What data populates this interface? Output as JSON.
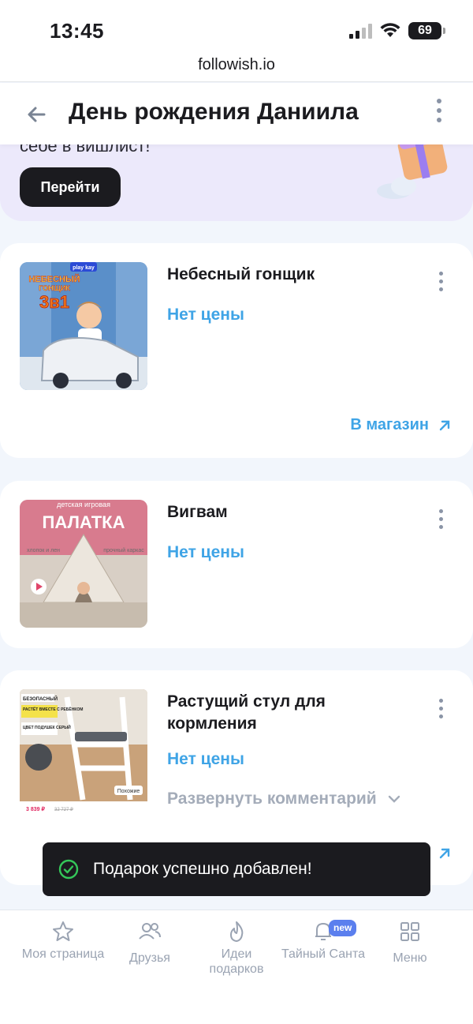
{
  "status_bar": {
    "time": "13:45",
    "battery": "69"
  },
  "browser": {
    "url": "followish.io"
  },
  "header": {
    "title": "День рождения Даниила"
  },
  "promo": {
    "text": "себе в вишлист!",
    "button_label": "Перейти"
  },
  "items": [
    {
      "title": "Небесный гонщик",
      "price": "Нет цены",
      "shop_label": "В магазин",
      "image_text": {
        "brand": "play kay",
        "line1": "НЕБЕСНЫЙ",
        "line2": "ГОНЩИК",
        "line3": "3в1"
      }
    },
    {
      "title": "Вигвам",
      "price": "Нет цены",
      "image_text": {
        "top": "детская игровая",
        "main": "ПАЛАТКА",
        "left_tag": "хлопок и лен",
        "right_tag": "прочный каркас"
      }
    },
    {
      "title": "Растущий стул для кормления",
      "price": "Нет цены",
      "expand_label": "Развернуть комментарий",
      "image_text": {
        "tag1": "БЕЗОПАСНЫЙ",
        "tag2": "РАСТЁТ ВМЕСТЕ С РЕБЁНКОМ",
        "tag3": "ЦВЕТ ПОДУШЕК СЕРЫЙ",
        "similar": "Похожие",
        "price_new": "3 839 ₽",
        "price_old": "32 727 ₽"
      }
    }
  ],
  "toast": {
    "message": "Подарок успешно добавлен!"
  },
  "bottom_nav": [
    {
      "label": "Моя страница",
      "icon": "star-icon"
    },
    {
      "label": "Друзья",
      "icon": "friends-icon"
    },
    {
      "label": "Идеи подарков",
      "icon": "flame-icon"
    },
    {
      "label": "Тайный Санта",
      "icon": "bell-icon",
      "badge": "new"
    },
    {
      "label": "Меню",
      "icon": "grid-icon"
    }
  ]
}
